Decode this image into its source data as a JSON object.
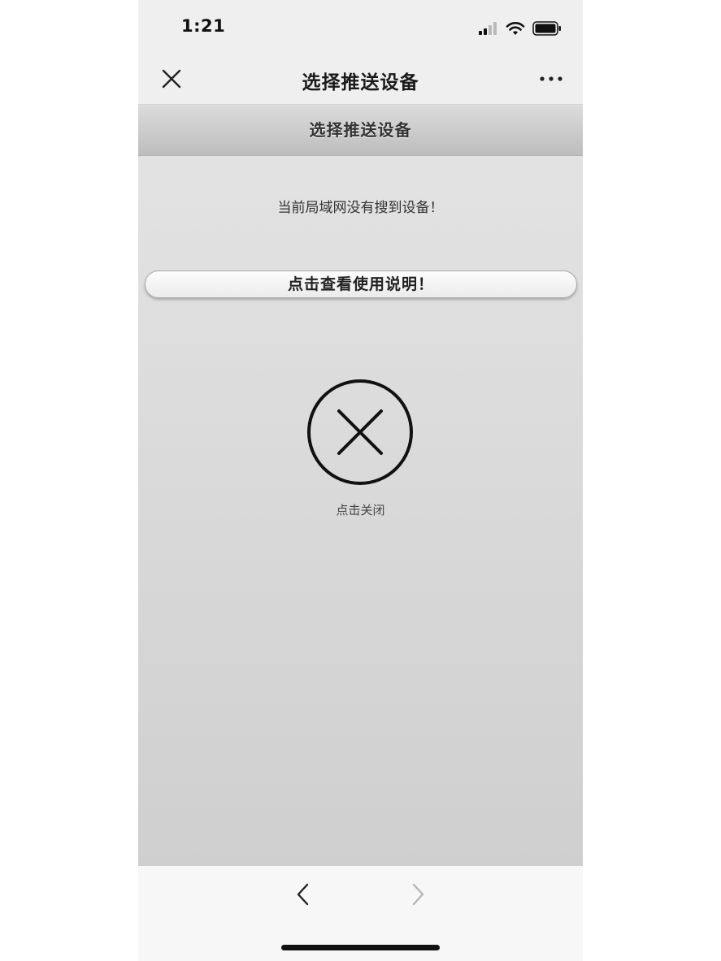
{
  "status_bar": {
    "time": "1:21"
  },
  "title_bar": {
    "title": "选择推送设备"
  },
  "page": {
    "header": "选择推送设备",
    "message": "当前局域网没有搜到设备！",
    "guide_button_label": "点击查看使用说明！",
    "close_label": "点击关闭"
  },
  "icons": {
    "close": "close-icon",
    "more": "more-icon",
    "close_circle": "close-circle-icon",
    "back": "chevron-left-icon",
    "forward": "chevron-right-icon",
    "signal": "signal-icon",
    "wifi": "wifi-icon",
    "battery": "battery-icon"
  },
  "colors": {
    "content_gradient_top": "#e4e4e4",
    "content_gradient_bottom": "#cfcfcf",
    "forward_disabled": "#b5b5b5"
  }
}
